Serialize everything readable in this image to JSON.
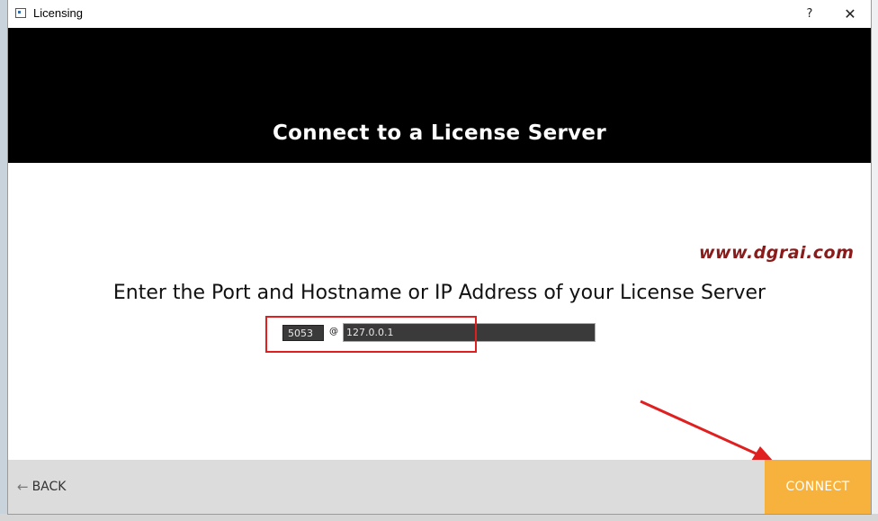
{
  "window": {
    "title": "Licensing",
    "help_label": "?",
    "close_label": "✕"
  },
  "header": {
    "title": "Connect to a License Server"
  },
  "watermark": "www.dgrai.com",
  "form": {
    "prompt": "Enter the Port and Hostname or IP Address of your License Server",
    "port_value": "5053",
    "separator": "@",
    "host_value": "127.0.0.1"
  },
  "footer": {
    "back_arrow": "←",
    "back_label": "BACK",
    "connect_label": "CONNECT"
  },
  "colors": {
    "header_bg": "#000000",
    "connect_bg": "#f6b23d",
    "annotation_red": "#e02020",
    "input_focus_border": "#e0a43a"
  }
}
